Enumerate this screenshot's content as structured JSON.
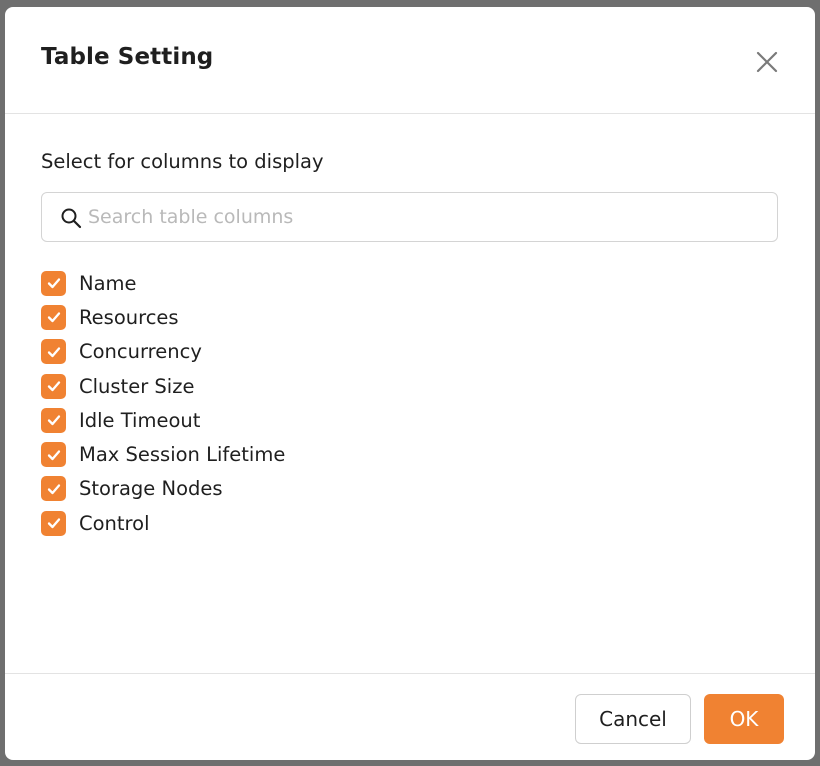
{
  "dialog": {
    "title": "Table Setting",
    "instruction": "Select for columns to display",
    "search": {
      "placeholder": "Search table columns",
      "value": ""
    },
    "columns": [
      {
        "label": "Name",
        "checked": true
      },
      {
        "label": "Resources",
        "checked": true
      },
      {
        "label": "Concurrency",
        "checked": true
      },
      {
        "label": "Cluster Size",
        "checked": true
      },
      {
        "label": "Idle Timeout",
        "checked": true
      },
      {
        "label": "Max Session Lifetime",
        "checked": true
      },
      {
        "label": "Storage Nodes",
        "checked": true
      },
      {
        "label": "Control",
        "checked": true
      }
    ],
    "footer": {
      "cancel_label": "Cancel",
      "ok_label": "OK"
    }
  },
  "icons": {
    "close": "close-icon",
    "search": "search-icon",
    "check": "checkmark-icon"
  },
  "colors": {
    "accent": "#f08232",
    "text": "#1f1f1f",
    "placeholder": "#b9b9b9",
    "border": "#d4d4d4"
  }
}
